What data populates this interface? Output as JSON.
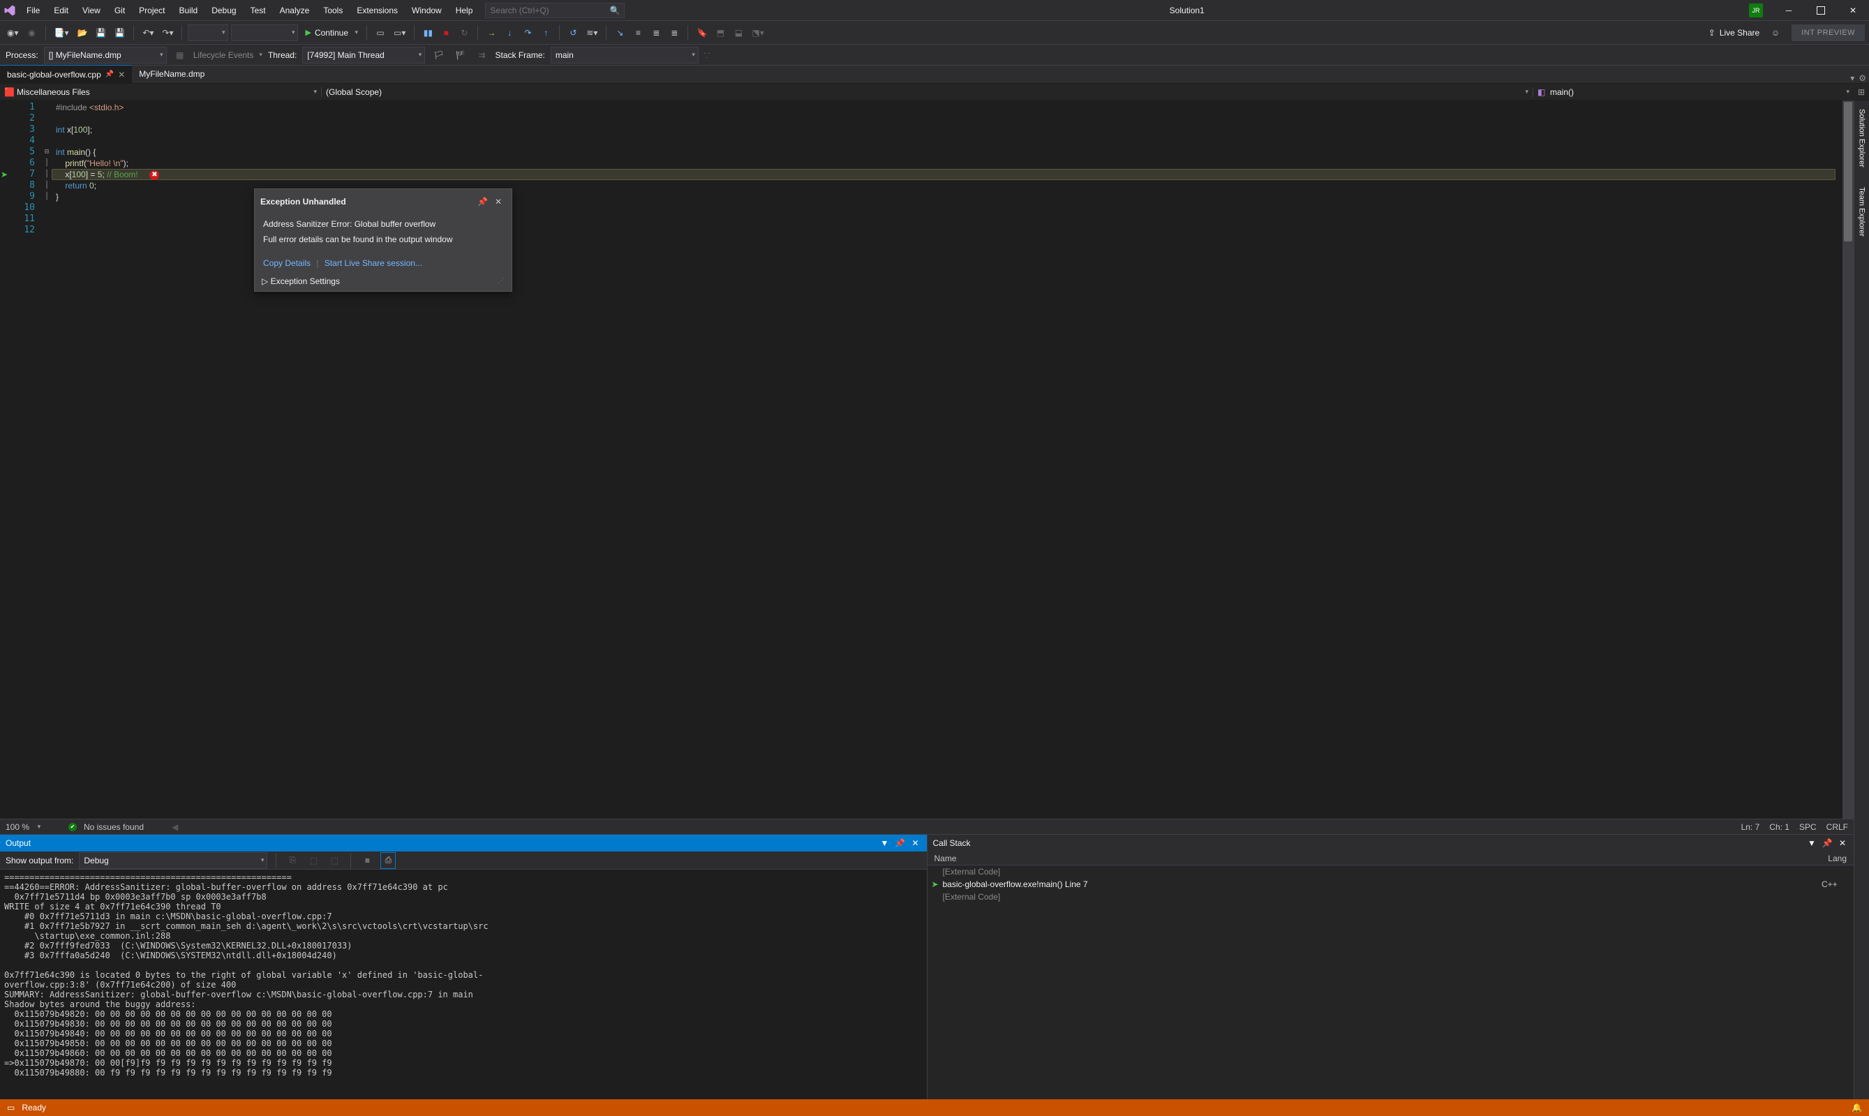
{
  "menu": [
    "File",
    "Edit",
    "View",
    "Git",
    "Project",
    "Build",
    "Debug",
    "Test",
    "Analyze",
    "Tools",
    "Extensions",
    "Window",
    "Help"
  ],
  "search_placeholder": "Search (Ctrl+Q)",
  "solution_name": "Solution1",
  "user_initials": "JR",
  "continue_label": "Continue",
  "live_share_label": "Live Share",
  "int_preview_label": "INT PREVIEW",
  "process_bar": {
    "process_label": "Process:",
    "process_value": "[] MyFileName.dmp",
    "lifecycle_label": "Lifecycle Events",
    "thread_label": "Thread:",
    "thread_value": "[74992] Main Thread",
    "stack_frame_label": "Stack Frame:",
    "stack_frame_value": "main"
  },
  "tabs": {
    "active": "basic-global-overflow.cpp",
    "second": "MyFileName.dmp"
  },
  "crumbs": {
    "project": "Miscellaneous Files",
    "scope": "(Global Scope)",
    "func": "main()"
  },
  "code": {
    "line_count": 12,
    "html": "<span class='pp'>#include</span> <span class='str'>&lt;stdio.h&gt;</span>\n\n<span class='kw'>int</span> x[<span class='num'>100</span>];\n\n<span class='kw'>int</span> <span class='fn'>main</span>() {\n    <span class='fn'>printf</span>(<span class='str'>\"Hello! \\n\"</span>);\n    x[<span class='num'>100</span>] = <span class='num'>5</span>; <span class='cmt'>// Boom!</span>  <span class='err-dot' data-name='error-glyph-icon' data-interactable='false'>✖</span>\n    <span class='kw'>return</span> <span class='num'>0</span>;\n}\n\n\n"
  },
  "exception": {
    "title": "Exception Unhandled",
    "message": "Address Sanitizer Error: Global buffer overflow",
    "detail": "Full error details can be found in the output window",
    "copy": "Copy Details",
    "liveshare": "Start Live Share session...",
    "settings": "Exception Settings"
  },
  "editor_status": {
    "zoom": "100 %",
    "issues": "No issues found",
    "ln": "Ln: 7",
    "ch": "Ch: 1",
    "spc": "SPC",
    "crlf": "CRLF"
  },
  "output": {
    "title": "Output",
    "show_label": "Show output from:",
    "show_value": "Debug",
    "text": "=========================================================\n==44260==ERROR: AddressSanitizer: global-buffer-overflow on address 0x7ff71e64c390 at pc\n  0x7ff71e5711d4 bp 0x0003e3aff7b0 sp 0x0003e3aff7b8\nWRITE of size 4 at 0x7ff71e64c390 thread T0\n    #0 0x7ff71e5711d3 in main c:\\MSDN\\basic-global-overflow.cpp:7\n    #1 0x7ff71e5b7927 in __scrt_common_main_seh d:\\agent\\_work\\2\\s\\src\\vctools\\crt\\vcstartup\\src\n      \\startup\\exe_common.inl:288\n    #2 0x7fff9fed7033  (C:\\WINDOWS\\System32\\KERNEL32.DLL+0x180017033)\n    #3 0x7fffa0a5d240  (C:\\WINDOWS\\SYSTEM32\\ntdll.dll+0x18004d240)\n\n0x7ff71e64c390 is located 0 bytes to the right of global variable 'x' defined in 'basic-global-\noverflow.cpp:3:8' (0x7ff71e64c200) of size 400\nSUMMARY: AddressSanitizer: global-buffer-overflow c:\\MSDN\\basic-global-overflow.cpp:7 in main\nShadow bytes around the buggy address:\n  0x115079b49820: 00 00 00 00 00 00 00 00 00 00 00 00 00 00 00 00\n  0x115079b49830: 00 00 00 00 00 00 00 00 00 00 00 00 00 00 00 00\n  0x115079b49840: 00 00 00 00 00 00 00 00 00 00 00 00 00 00 00 00\n  0x115079b49850: 00 00 00 00 00 00 00 00 00 00 00 00 00 00 00 00\n  0x115079b49860: 00 00 00 00 00 00 00 00 00 00 00 00 00 00 00 00\n=>0x115079b49870: 00 00[f9]f9 f9 f9 f9 f9 f9 f9 f9 f9 f9 f9 f9 f9\n  0x115079b49880: 00 f9 f9 f9 f9 f9 f9 f9 f9 f9 f9 f9 f9 f9 f9 f9"
  },
  "callstack": {
    "title": "Call Stack",
    "col_name": "Name",
    "col_lang": "Lang",
    "rows": [
      {
        "ext": true,
        "text": "[External Code]",
        "lang": ""
      },
      {
        "ext": false,
        "text": "basic-global-overflow.exe!main() Line 7",
        "lang": "C++",
        "current": true
      },
      {
        "ext": true,
        "text": "[External Code]",
        "lang": ""
      }
    ]
  },
  "side_tabs": [
    "Solution Explorer",
    "Team Explorer"
  ],
  "statusbar": {
    "ready": "Ready"
  }
}
